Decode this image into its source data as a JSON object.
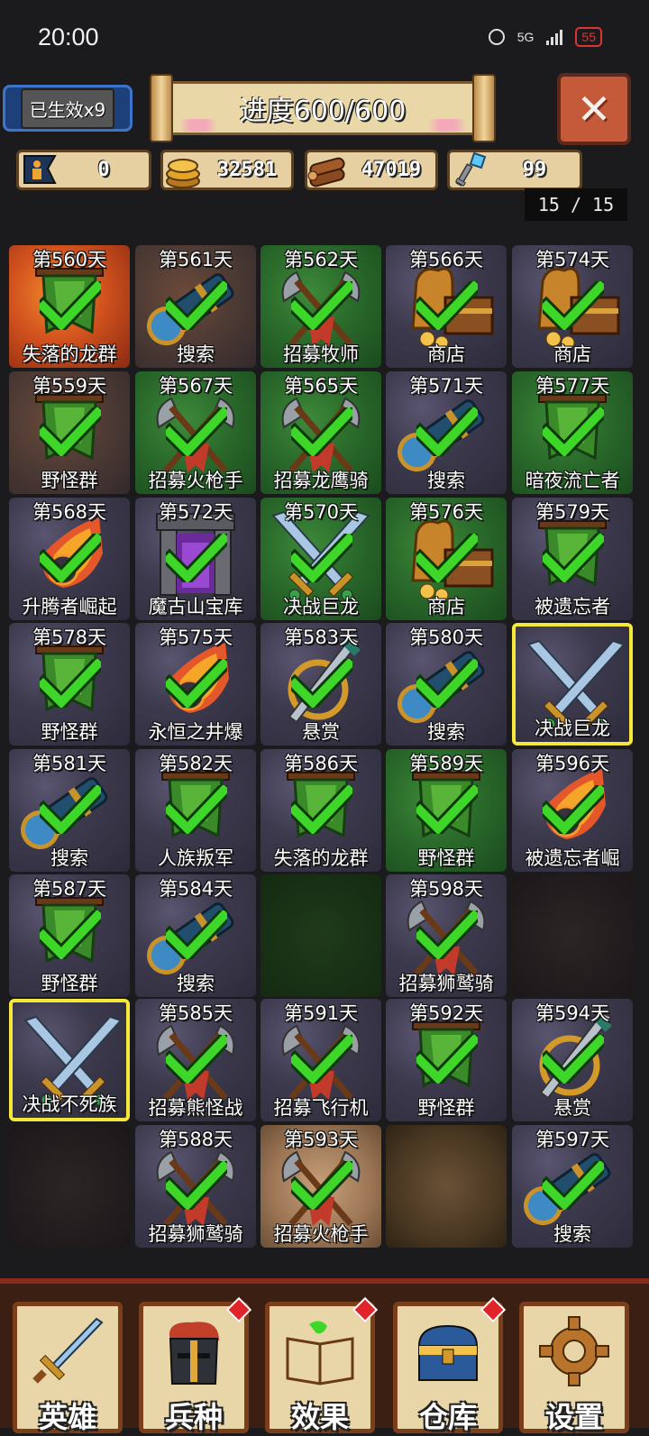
{
  "status_bar": {
    "time": "20:00",
    "network": "5G",
    "battery": "55"
  },
  "header": {
    "effect_label": "已生效x9",
    "progress_label": "进度600/600",
    "close_icon": "close-x-icon"
  },
  "resources": [
    {
      "name": "population",
      "icon": "person-flag-icon",
      "value": "0"
    },
    {
      "name": "gold",
      "icon": "gold-coins-icon",
      "value": "32581"
    },
    {
      "name": "wood",
      "icon": "wood-logs-icon",
      "value": "47019"
    },
    {
      "name": "key",
      "icon": "crystal-key-icon",
      "value": "99"
    }
  ],
  "page_counter": "15 / 15",
  "grid": [
    [
      {
        "day": "第560天",
        "label": "失落的龙群",
        "bg": "lava",
        "art": "banner",
        "done": true
      },
      {
        "day": "第561天",
        "label": "搜索",
        "bg": "mud",
        "art": "spyglass",
        "done": true
      },
      {
        "day": "第562天",
        "label": "招募牧师",
        "bg": "grass",
        "art": "axes",
        "done": true
      },
      {
        "day": "第566天",
        "label": "商店",
        "bg": "stone",
        "art": "treasure",
        "done": true
      },
      {
        "day": "第574天",
        "label": "商店",
        "bg": "stone",
        "art": "treasure",
        "done": true
      }
    ],
    [
      {
        "day": "第559天",
        "label": "野怪群",
        "bg": "mud",
        "art": "banner",
        "done": true
      },
      {
        "day": "第567天",
        "label": "招募火枪手",
        "bg": "grass",
        "art": "axes",
        "done": true
      },
      {
        "day": "第565天",
        "label": "招募龙鹰骑",
        "bg": "grass",
        "art": "axes",
        "done": true
      },
      {
        "day": "第571天",
        "label": "搜索",
        "bg": "stone",
        "art": "spyglass",
        "done": true
      },
      {
        "day": "第577天",
        "label": "暗夜流亡者",
        "bg": "grass",
        "art": "banner",
        "done": true
      }
    ],
    [
      {
        "day": "第568天",
        "label": "升腾者崛起",
        "bg": "stone",
        "art": "meteor",
        "done": true
      },
      {
        "day": "第572天",
        "label": "魔古山宝库",
        "bg": "stone",
        "art": "portal",
        "done": true
      },
      {
        "day": "第570天",
        "label": "决战巨龙",
        "bg": "grass",
        "art": "swords",
        "done": true
      },
      {
        "day": "第576天",
        "label": "商店",
        "bg": "grass",
        "art": "treasure",
        "done": true
      },
      {
        "day": "第579天",
        "label": "被遗忘者",
        "bg": "stone",
        "art": "banner",
        "done": true
      }
    ],
    [
      {
        "day": "第578天",
        "label": "野怪群",
        "bg": "stone",
        "art": "banner",
        "done": true
      },
      {
        "day": "第575天",
        "label": "永恒之井爆",
        "bg": "stone",
        "art": "meteor",
        "done": true
      },
      {
        "day": "第583天",
        "label": "悬赏",
        "bg": "stone",
        "art": "dagger",
        "done": true
      },
      {
        "day": "第580天",
        "label": "搜索",
        "bg": "stone",
        "art": "spyglass",
        "done": true
      },
      {
        "day": "",
        "label": "决战巨龙",
        "bg": "stone",
        "art": "swords",
        "done": false,
        "selected": true
      }
    ],
    [
      {
        "day": "第581天",
        "label": "搜索",
        "bg": "stone",
        "art": "spyglass",
        "done": true
      },
      {
        "day": "第582天",
        "label": "人族叛军",
        "bg": "stone",
        "art": "banner",
        "done": true
      },
      {
        "day": "第586天",
        "label": "失落的龙群",
        "bg": "stone",
        "art": "banner",
        "done": true
      },
      {
        "day": "第589天",
        "label": "野怪群",
        "bg": "grass",
        "art": "banner",
        "done": true
      },
      {
        "day": "第596天",
        "label": "被遗忘者崛",
        "bg": "stone",
        "art": "meteor",
        "done": true
      }
    ],
    [
      {
        "day": "第587天",
        "label": "野怪群",
        "bg": "stone",
        "art": "banner",
        "done": true
      },
      {
        "day": "第584天",
        "label": "搜索",
        "bg": "stone",
        "art": "spyglass",
        "done": true
      },
      {
        "day": "",
        "label": "",
        "bg": "darkgrass",
        "art": "none",
        "done": false
      },
      {
        "day": "第598天",
        "label": "招募狮鹫骑",
        "bg": "stone",
        "art": "axes",
        "done": true
      },
      {
        "day": "",
        "label": "",
        "bg": "darklava",
        "art": "none",
        "done": false
      }
    ],
    [
      {
        "day": "",
        "label": "决战不死族",
        "bg": "stone",
        "art": "swords",
        "done": false,
        "selected": true
      },
      {
        "day": "第585天",
        "label": "招募熊怪战",
        "bg": "stone",
        "art": "axes",
        "done": true
      },
      {
        "day": "第591天",
        "label": "招募飞行机",
        "bg": "stone",
        "art": "axes",
        "done": true
      },
      {
        "day": "第592天",
        "label": "野怪群",
        "bg": "stone",
        "art": "banner",
        "done": true
      },
      {
        "day": "第594天",
        "label": "悬赏",
        "bg": "stone",
        "art": "dagger",
        "done": true
      }
    ],
    [
      {
        "day": "",
        "label": "",
        "bg": "darklava",
        "art": "none",
        "done": false
      },
      {
        "day": "第588天",
        "label": "招募狮鹫骑",
        "bg": "stone",
        "art": "axes",
        "done": true
      },
      {
        "day": "第593天",
        "label": "招募火枪手",
        "bg": "sand",
        "art": "axes",
        "done": true
      },
      {
        "day": "",
        "label": "",
        "bg": "rock",
        "art": "none",
        "done": false
      },
      {
        "day": "第597天",
        "label": "搜索",
        "bg": "stone",
        "art": "spyglass",
        "done": true
      }
    ]
  ],
  "bottom_nav": [
    {
      "label": "英雄",
      "icon": "sword-icon",
      "badge": false
    },
    {
      "label": "兵种",
      "icon": "knight-helmet-icon",
      "badge": true
    },
    {
      "label": "效果",
      "icon": "spellbook-icon",
      "badge": true
    },
    {
      "label": "仓库",
      "icon": "treasure-chest-icon",
      "badge": true
    },
    {
      "label": "设置",
      "icon": "gear-icon",
      "badge": false
    }
  ],
  "colors": {
    "selected_border": "#f6e83a",
    "check_green": "#3fd62a",
    "badge_red": "#e0242a"
  }
}
